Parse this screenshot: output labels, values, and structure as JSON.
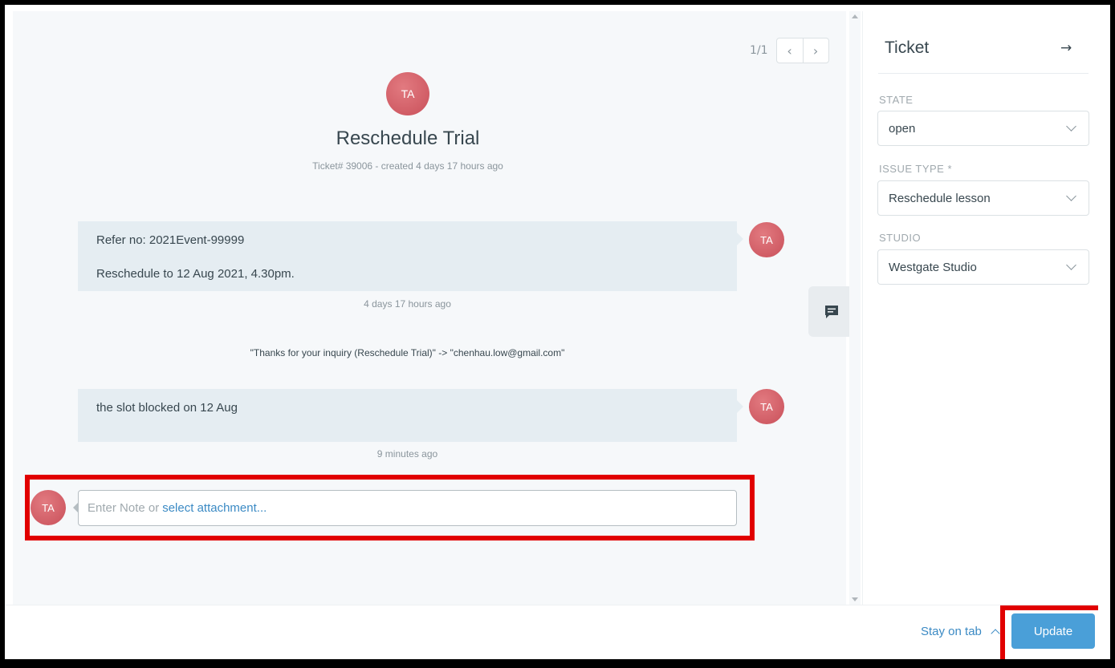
{
  "pager": {
    "count": "1/1",
    "prev_icon": "chevron-left-icon",
    "next_icon": "chevron-right-icon"
  },
  "ticket": {
    "avatar_initials": "TA",
    "title": "Reschedule Trial",
    "meta": "Ticket# 39006 - created 4 days 17 hours ago"
  },
  "messages": [
    {
      "lines": [
        "Refer no: 2021Event-99999",
        "Reschedule to 12 Aug 2021, 4.30pm."
      ],
      "avatar": "TA",
      "time": "4 days 17 hours ago"
    },
    {
      "lines": [
        "the slot blocked on 12 Aug"
      ],
      "avatar": "TA",
      "time": "9 minutes ago"
    }
  ],
  "system_line": "\"Thanks for your inquiry (Reschedule Trial)\" -> \"chenhau.low@gmail.com\"",
  "note": {
    "avatar": "TA",
    "placeholder": "Enter Note or",
    "link": "select attachment..."
  },
  "sidebar": {
    "title": "Ticket",
    "collapse_icon": "arrow-right-icon",
    "fields": [
      {
        "label": "STATE",
        "value": "open"
      },
      {
        "label": "ISSUE TYPE *",
        "value": "Reschedule lesson"
      },
      {
        "label": "STUDIO",
        "value": "Westgate Studio"
      }
    ]
  },
  "footer": {
    "stay_on_tab": "Stay on tab",
    "update": "Update"
  },
  "colors": {
    "accent": "#4a9fd8",
    "link": "#3b8ac4",
    "highlight": "#e10000",
    "avatar": "#d25b65",
    "bubble": "#e5edf2"
  }
}
